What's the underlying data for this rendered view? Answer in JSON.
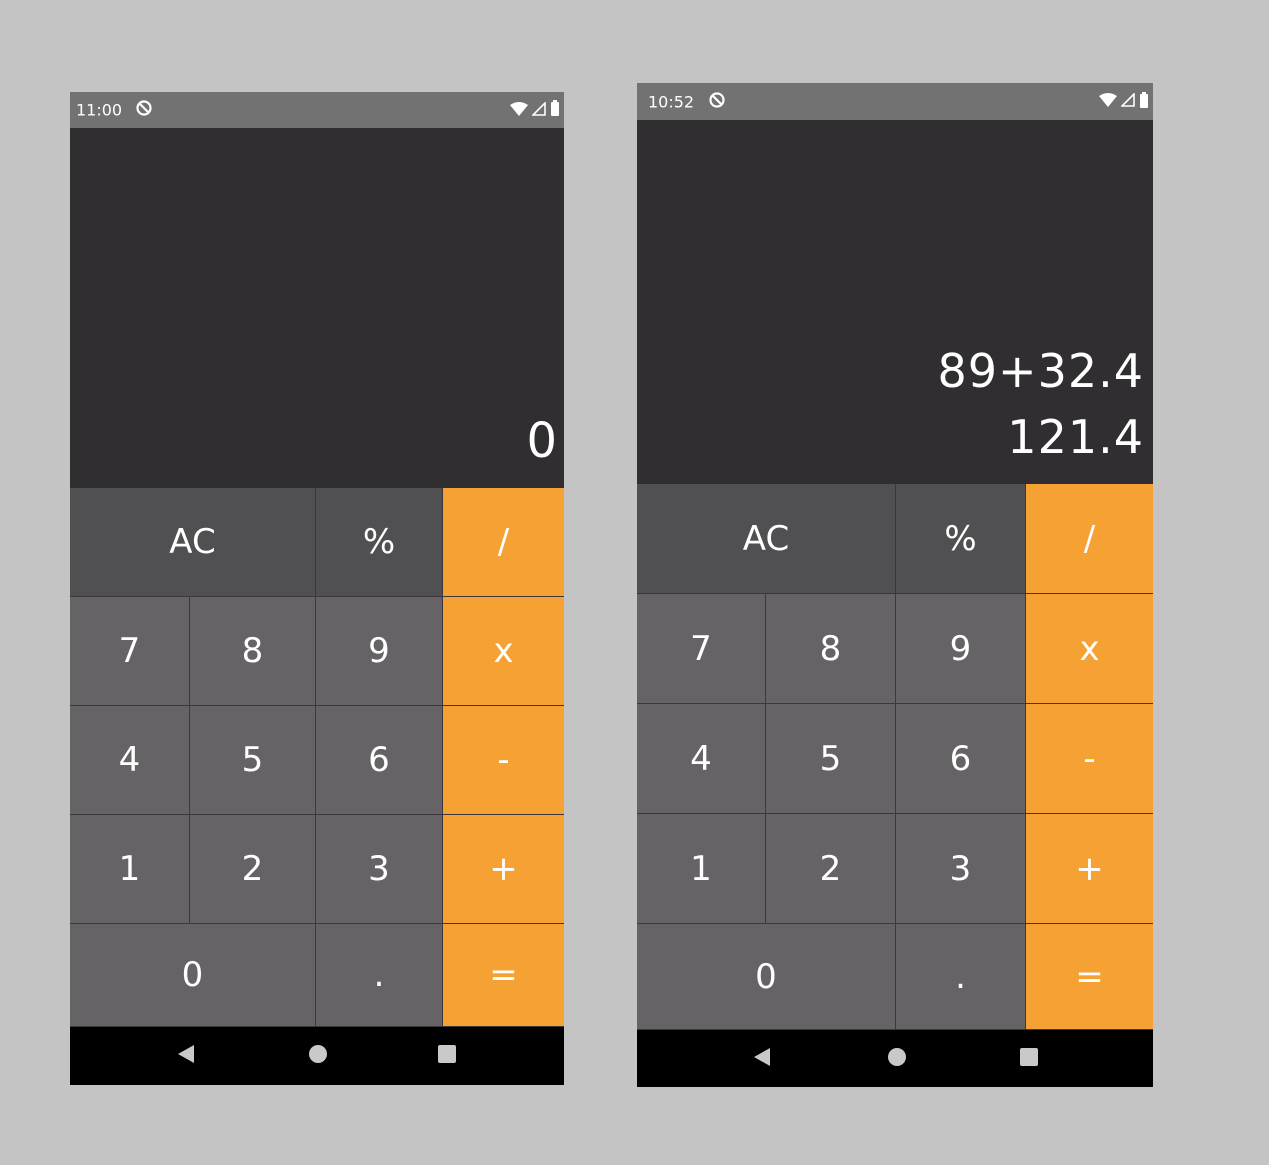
{
  "screens": [
    {
      "status": {
        "time": "11:00"
      },
      "display": {
        "expression": "",
        "result": "0"
      },
      "keys": {
        "ac": "AC",
        "percent": "%",
        "divide": "/",
        "seven": "7",
        "eight": "8",
        "nine": "9",
        "multiply": "x",
        "four": "4",
        "five": "5",
        "six": "6",
        "minus": "-",
        "one": "1",
        "two": "2",
        "three": "3",
        "plus": "+",
        "zero": "0",
        "decimal": ".",
        "equals": "="
      }
    },
    {
      "status": {
        "time": "10:52"
      },
      "display": {
        "expression": "89+32.4",
        "result": "121.4"
      },
      "keys": {
        "ac": "AC",
        "percent": "%",
        "divide": "/",
        "seven": "7",
        "eight": "8",
        "nine": "9",
        "multiply": "x",
        "four": "4",
        "five": "5",
        "six": "6",
        "minus": "-",
        "one": "1",
        "two": "2",
        "three": "3",
        "plus": "+",
        "zero": "0",
        "decimal": ".",
        "equals": "="
      }
    }
  ],
  "colors": {
    "background": "#c4c4c4",
    "status_bar": "#727272",
    "display": "#302e31",
    "function_key": "#505052",
    "number_key": "#656365",
    "operator_key": "#f5a134",
    "nav_bar": "#000000"
  },
  "icons": {
    "status": [
      "data-saver-icon",
      "wifi-icon",
      "cellular-signal-icon",
      "battery-icon"
    ],
    "nav": [
      "back-triangle-icon",
      "home-circle-icon",
      "recents-square-icon"
    ]
  }
}
